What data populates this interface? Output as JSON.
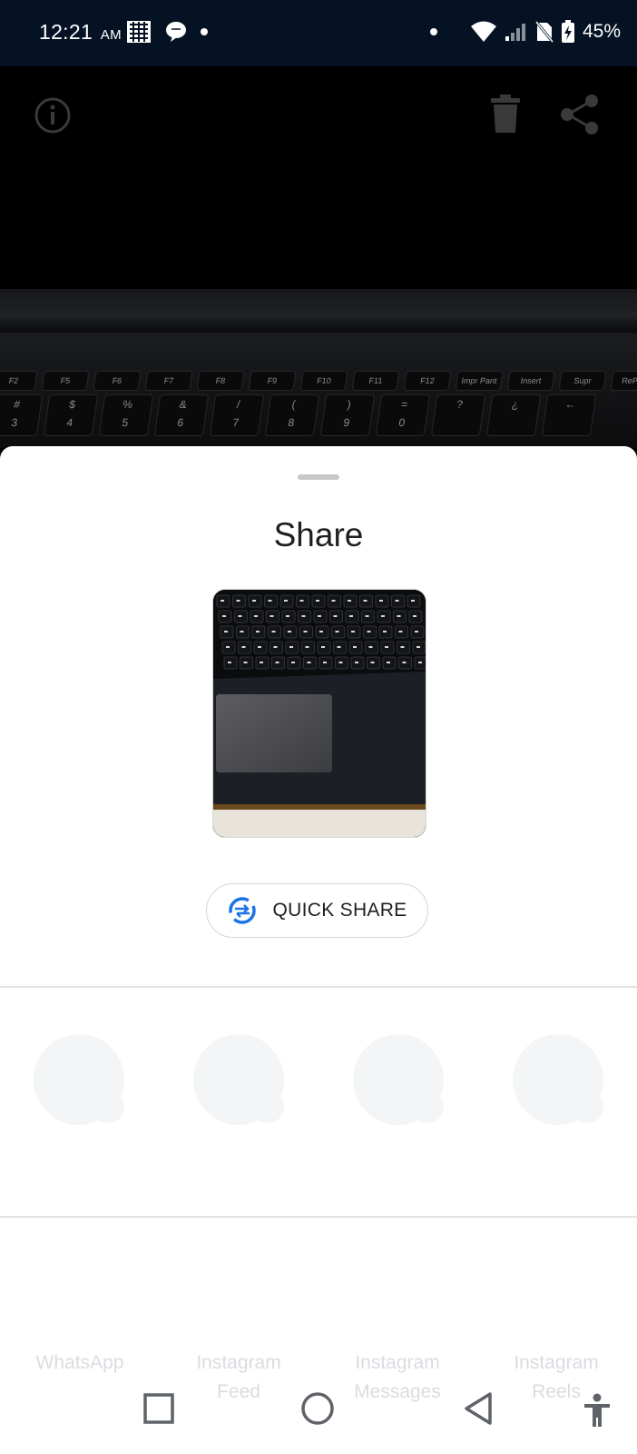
{
  "status_bar": {
    "time": "12:21",
    "ampm": "AM",
    "battery": "45%"
  },
  "viewer": {
    "keys_row1": [
      "F2",
      "F5",
      "F6",
      "F7",
      "F8",
      "F9",
      "F10",
      "F11",
      "F12",
      "Impr Pant",
      "Insert",
      "Supr",
      "RePág"
    ],
    "keys_row2": [
      "3",
      "4",
      "5",
      "6",
      "7",
      "8",
      "9",
      "0",
      "?",
      "¿",
      "←"
    ],
    "keys_row2_top": [
      "#",
      "$",
      "%",
      "&",
      "/",
      "(",
      ")",
      "=",
      "",
      "",
      ""
    ]
  },
  "sheet": {
    "title": "Share",
    "quick_share_label": "QUICK SHARE"
  },
  "apps": [
    {
      "label": "WhatsApp",
      "label2": ""
    },
    {
      "label": "Instagram",
      "label2": "Feed"
    },
    {
      "label": "Instagram",
      "label2": "Messages"
    },
    {
      "label": "Instagram",
      "label2": "Reels"
    }
  ],
  "icons": {
    "info": "info-icon",
    "delete": "trash-icon",
    "share": "share-icon",
    "quick_share": "quick-share-icon",
    "nav_recents": "square-icon",
    "nav_home": "circle-icon",
    "nav_back": "triangle-back-icon",
    "accessibility": "accessibility-icon"
  },
  "colors": {
    "status_bar_bg": "#041224",
    "sheet_bg": "#ffffff",
    "quick_share_accent": "#1a73e8",
    "placeholder": "#f3f5f7"
  }
}
